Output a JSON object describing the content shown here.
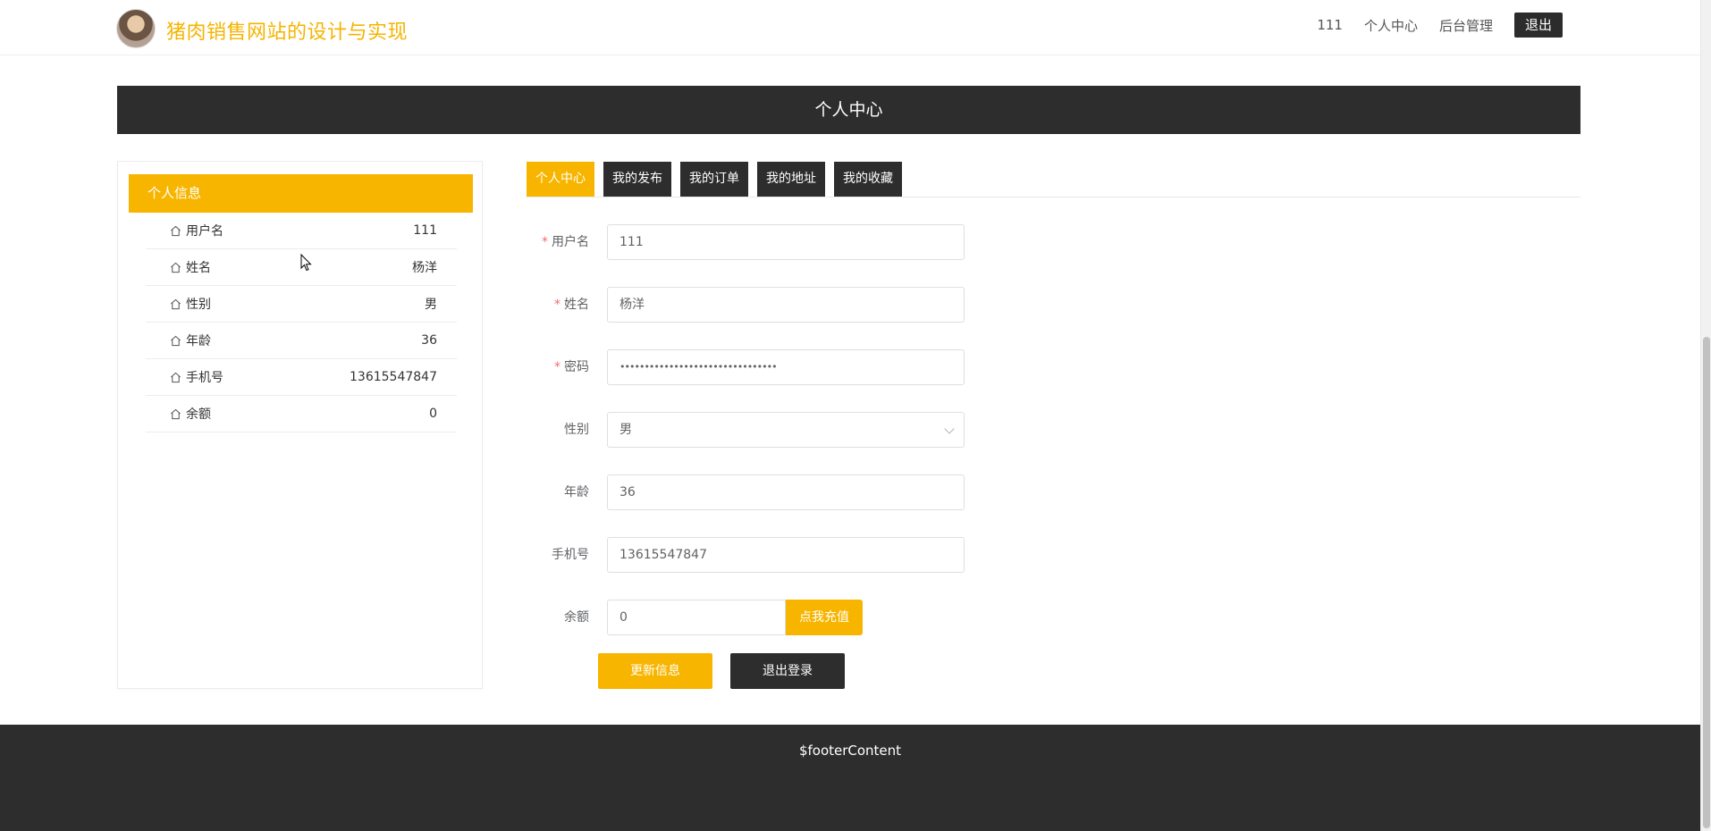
{
  "header": {
    "site_title": "猪肉销售网站的设计与实现",
    "nav": {
      "username": "111",
      "profile": "个人中心",
      "admin": "后台管理",
      "logout": "退出"
    }
  },
  "banner": {
    "title": "个人中心"
  },
  "info_panel": {
    "title": "个人信息",
    "rows": [
      {
        "label": "用户名",
        "value": "111"
      },
      {
        "label": "姓名",
        "value": "杨洋"
      },
      {
        "label": "性别",
        "value": "男"
      },
      {
        "label": "年龄",
        "value": "36"
      },
      {
        "label": "手机号",
        "value": "13615547847"
      },
      {
        "label": "余额",
        "value": "0"
      }
    ]
  },
  "tabs": [
    "个人中心",
    "我的发布",
    "我的订单",
    "我的地址",
    "我的收藏"
  ],
  "form": {
    "username": {
      "label": "用户名",
      "value": "111"
    },
    "name": {
      "label": "姓名",
      "value": "杨洋"
    },
    "password": {
      "label": "密码",
      "value": "••••••••••••••••••••••••••••••••"
    },
    "gender": {
      "label": "性别",
      "value": "男"
    },
    "age": {
      "label": "年龄",
      "value": "36"
    },
    "phone": {
      "label": "手机号",
      "value": "13615547847"
    },
    "balance": {
      "label": "余额",
      "value": "0",
      "recharge": "点我充值"
    },
    "required_mark": "*"
  },
  "buttons": {
    "update": "更新信息",
    "logout": "退出登录"
  },
  "footer": {
    "content": "$footerContent"
  },
  "colors": {
    "accent": "#f8b500",
    "dark": "#2d2d2d",
    "title": "#f5b400"
  }
}
